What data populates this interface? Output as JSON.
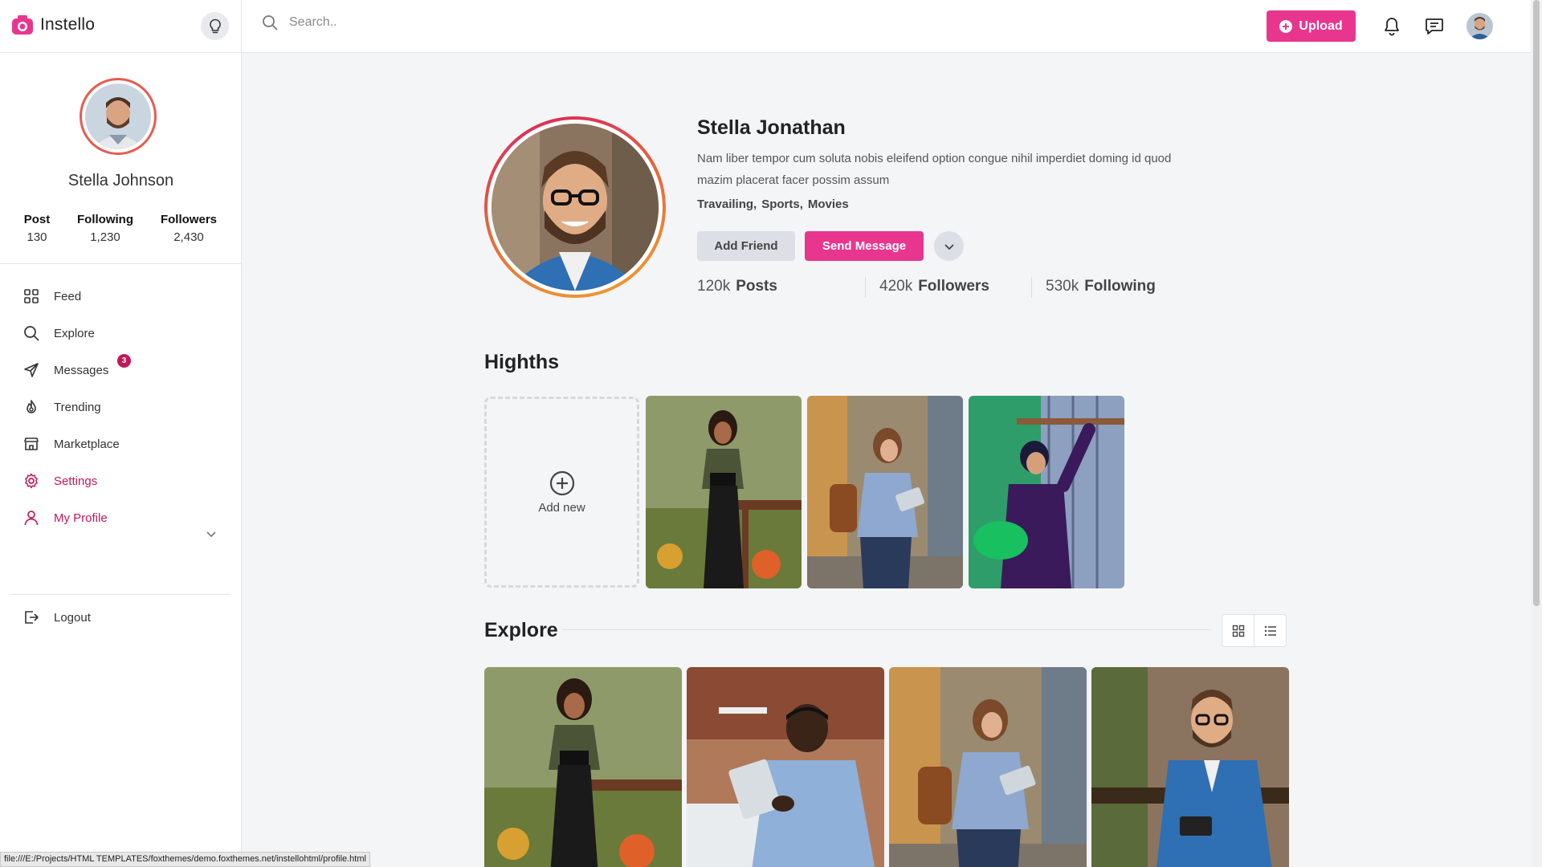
{
  "app": {
    "name": "Instello"
  },
  "search": {
    "placeholder": "Search.."
  },
  "header": {
    "upload_label": "Upload"
  },
  "sidebar": {
    "user_name": "Stella Johnson",
    "stats": [
      {
        "label": "Post",
        "value": "130"
      },
      {
        "label": "Following",
        "value": "1,230"
      },
      {
        "label": "Followers",
        "value": "2,430"
      }
    ],
    "nav": [
      {
        "label": "Feed",
        "icon": "grid-icon"
      },
      {
        "label": "Explore",
        "icon": "search-icon"
      },
      {
        "label": "Messages",
        "icon": "send-icon",
        "badge": "3"
      },
      {
        "label": "Trending",
        "icon": "flame-icon"
      },
      {
        "label": "Marketplace",
        "icon": "store-icon"
      },
      {
        "label": "Settings",
        "icon": "gear-icon"
      },
      {
        "label": "My Profile",
        "icon": "user-icon"
      }
    ],
    "logout_label": "Logout"
  },
  "profile": {
    "name": "Stella Jonathan",
    "bio": "Nam liber tempor cum soluta nobis eleifend option congue nihil imperdiet doming id quod mazim placerat facer possim assum",
    "tags": [
      "Travailing,",
      "Sports,",
      "Movies"
    ],
    "add_friend_label": "Add Friend",
    "send_message_label": "Send Message",
    "counts": [
      {
        "value": "120k",
        "label": "Posts"
      },
      {
        "value": "420k",
        "label": "Followers"
      },
      {
        "value": "530k",
        "label": "Following"
      }
    ]
  },
  "highlights": {
    "title": "Highths",
    "add_new_label": "Add new"
  },
  "explore": {
    "title": "Explore"
  },
  "status_url": "file:///E:/Projects/HTML TEMPLATES/foxthemes/demo.foxthemes.net/instellohtml/profile.html",
  "colors": {
    "accent": "#e8368f",
    "active": "#c2185b",
    "ring": "#ea5a4f"
  }
}
